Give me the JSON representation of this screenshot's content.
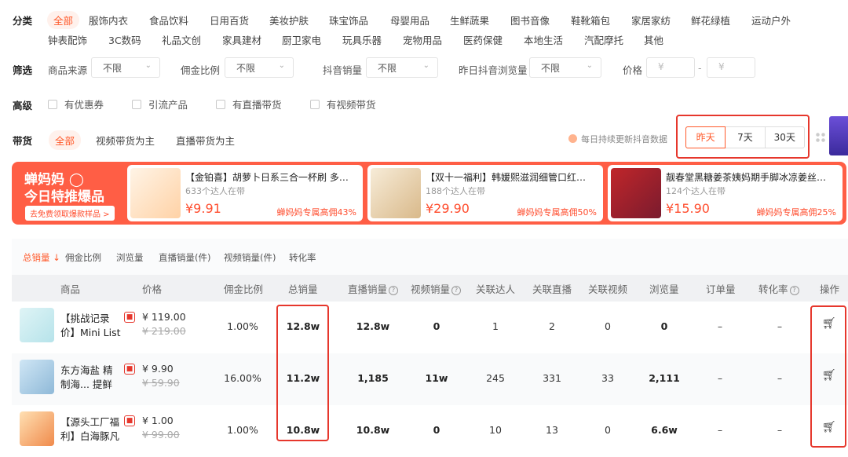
{
  "filters": {
    "category_label": "分类",
    "categories": [
      "全部",
      "服饰内衣",
      "食品饮料",
      "日用百货",
      "美妆护肤",
      "珠宝饰品",
      "母婴用品",
      "生鲜蔬果",
      "图书音像",
      "鞋靴箱包",
      "家居家纺",
      "鲜花绿植",
      "运动户外",
      "钟表配饰",
      "3C数码",
      "礼品文创",
      "家具建材",
      "厨卫家电",
      "玩具乐器",
      "宠物用品",
      "医药保健",
      "本地生活",
      "汽配摩托",
      "其他"
    ],
    "filter_label": "筛选",
    "source_label": "商品来源",
    "source_value": "不限",
    "commission_label": "佣金比例",
    "commission_value": "不限",
    "douyin_sales_label": "抖音销量",
    "douyin_sales_value": "不限",
    "yesterday_views_label": "昨日抖音浏览量",
    "yesterday_views_value": "不限",
    "price_label": "价格",
    "price_min_placeholder": "¥",
    "price_sep": "-",
    "price_max_placeholder": "¥",
    "advanced_label": "高级",
    "advanced_options": [
      "有优惠券",
      "引流产品",
      "有直播带货",
      "有视频带货"
    ],
    "promo_label": "带货",
    "promo_options": [
      "全部",
      "视频带货为主",
      "直播带货为主"
    ],
    "update_note": "每日持续更新抖音数据",
    "date_tabs": [
      "昨天",
      "7天",
      "30天"
    ]
  },
  "promo_banner": {
    "title_line1": "蝉妈妈",
    "title_line2": "今日特推爆品",
    "cta": "去免费领取爆款样品 >",
    "cards": [
      {
        "title": "【金铂喜】胡萝卜日系三合一杯刷 多功能...",
        "sub": "633个达人在带",
        "price": "¥9.91",
        "commission": "蝉妈妈专属高佣43%"
      },
      {
        "title": "【双十一福利】韩媛熙滋润细管口红不易粘...",
        "sub": "188个达人在带",
        "price": "¥29.90",
        "commission": "蝉妈妈专属高佣50%"
      },
      {
        "title": "靓春堂黑糖姜茶姨妈期手脚冰凉姜丝红枣桂...",
        "sub": "124个达人在带",
        "price": "¥15.90",
        "commission": "蝉妈妈专属高佣25%"
      }
    ]
  },
  "sort_tabs": [
    "总销量",
    "佣金比例",
    "浏览量",
    "直播销量(件)",
    "视频销量(件)",
    "转化率"
  ],
  "columns": [
    "商品",
    "价格",
    "佣金比例",
    "总销量",
    "直播销量",
    "视频销量",
    "关联达人",
    "关联直播",
    "关联视频",
    "浏览量",
    "订单量",
    "转化率",
    "操作"
  ],
  "rows": [
    {
      "name": "【挑战记录价】Mini List",
      "price": "¥ 119.00",
      "orig_price": "¥ 219.00",
      "commission": "1.00%",
      "total_sales": "12.8w",
      "live_sales": "12.8w",
      "video_sales": "0",
      "creators": "1",
      "lives": "2",
      "videos": "0",
      "views": "0",
      "orders": "–",
      "conversion": "–"
    },
    {
      "name": "东方海盐 精制海... 提鲜",
      "price": "¥ 9.90",
      "orig_price": "¥ 59.90",
      "commission": "16.00%",
      "total_sales": "11.2w",
      "live_sales": "1,185",
      "video_sales": "11w",
      "creators": "245",
      "lives": "331",
      "videos": "33",
      "views": "2,111",
      "orders": "–",
      "conversion": "–"
    },
    {
      "name": "【源头工厂福利】白海豚凡",
      "price": "¥ 1.00",
      "orig_price": "¥ 99.00",
      "commission": "1.00%",
      "total_sales": "10.8w",
      "live_sales": "10.8w",
      "video_sales": "0",
      "creators": "10",
      "lives": "13",
      "videos": "0",
      "views": "6.6w",
      "orders": "–",
      "conversion": "–"
    }
  ],
  "colors": {
    "accent": "#ff5a2b",
    "highlight_box": "#e6372c",
    "banner_bg": "#ff5e45"
  }
}
